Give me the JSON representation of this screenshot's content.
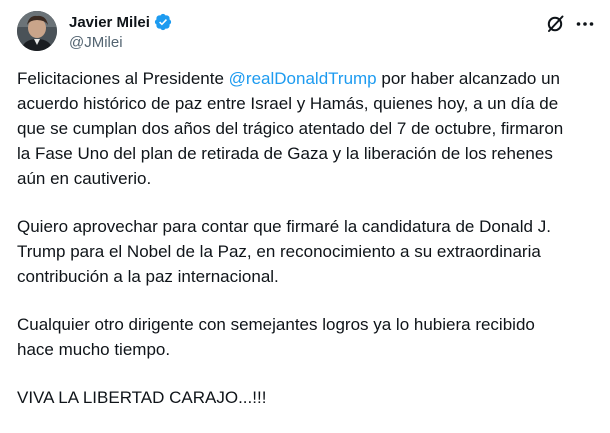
{
  "author": {
    "display_name": "Javier Milei",
    "handle": "@JMilei",
    "verified_color": "#1d9bf0"
  },
  "icons": {
    "grok": "grok-slash-icon",
    "more": "more-dots-icon"
  },
  "tweet": {
    "p1_before": "Felicitaciones al Presidente ",
    "p1_mention": "@realDonaldTrump",
    "p1_after": " por haber alcanzado un\nacuerdo histórico de paz entre Israel y Hamás, quienes hoy, a un día de\nque se cumplan dos años del trágico atentado del 7 de octubre, firmaron\nla Fase Uno del plan de retirada de Gaza y la liberación de los rehenes\naún en cautiverio.",
    "p2": "Quiero aprovechar para contar que firmaré la candidatura de Donald J.\nTrump para el Nobel de la Paz, en reconocimiento a su extraordinaria\ncontribución a la paz internacional.",
    "p3": "Cualquier otro dirigente con semejantes logros ya lo hubiera recibido\nhace mucho tiempo.",
    "p4": "VIVA LA LIBERTAD CARAJO...!!!"
  },
  "colors": {
    "text": "#0f1419",
    "secondary": "#536471",
    "link": "#1d9bf0"
  }
}
